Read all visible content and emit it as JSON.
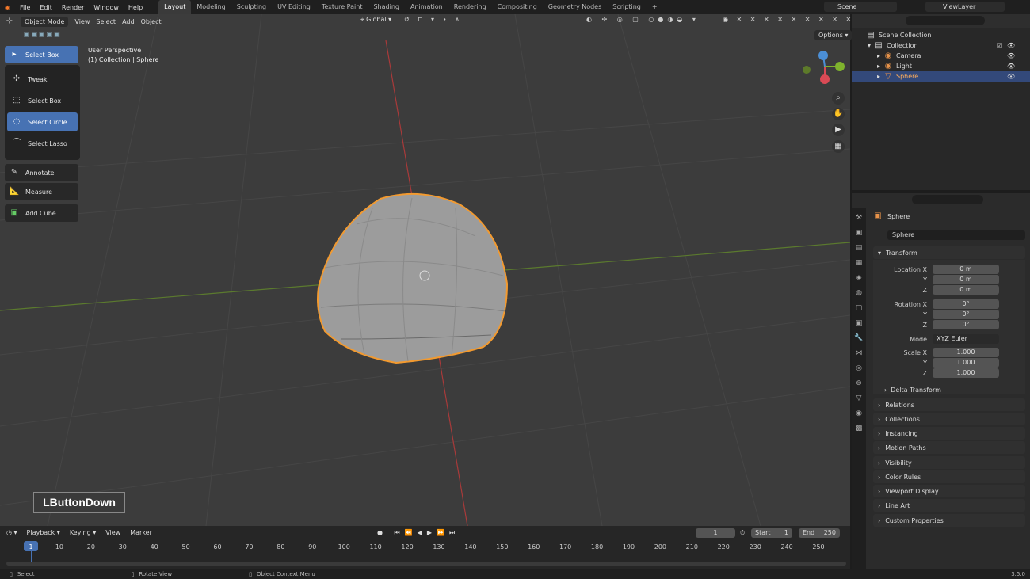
{
  "menu": [
    "File",
    "Edit",
    "Render",
    "Window",
    "Help"
  ],
  "workspaces": [
    "Layout",
    "Modeling",
    "Sculpting",
    "UV Editing",
    "Texture Paint",
    "Shading",
    "Animation",
    "Rendering",
    "Compositing",
    "Geometry Nodes",
    "Scripting"
  ],
  "scene": "Scene",
  "view_layer": "ViewLayer",
  "viewport": {
    "mode": "Object Mode",
    "header_menus": [
      "View",
      "Select",
      "Add",
      "Object"
    ],
    "orientation": "Global",
    "options": "Options",
    "perspective": "User Perspective",
    "collection_info": "(1) Collection | Sphere"
  },
  "toolbar": {
    "active": "Select Box",
    "flyout": [
      "Tweak",
      "Select Box",
      "Select Circle",
      "Select Lasso"
    ],
    "tools": [
      "Annotate",
      "Measure",
      "Add Cube"
    ]
  },
  "overlay_key": "LButtonDown",
  "outliner": {
    "root": "Scene Collection",
    "collection": "Collection",
    "items": [
      "Camera",
      "Light",
      "Sphere"
    ]
  },
  "properties": {
    "object": "Sphere",
    "datablock": "Sphere",
    "transform": "Transform",
    "location_label": "Location X",
    "rotation_label": "Rotation X",
    "scale_label": "Scale X",
    "axis_y": "Y",
    "axis_z": "Z",
    "mode_label": "Mode",
    "mode_value": "XYZ Euler",
    "loc": [
      "0 m",
      "0 m",
      "0 m"
    ],
    "rot": [
      "0°",
      "0°",
      "0°"
    ],
    "scale": [
      "1.000",
      "1.000",
      "1.000"
    ],
    "delta": "Delta Transform",
    "sections": [
      "Relations",
      "Collections",
      "Instancing",
      "Motion Paths",
      "Visibility",
      "Color Rules",
      "Viewport Display",
      "Line Art",
      "Custom Properties"
    ]
  },
  "timeline": {
    "menus": [
      "Playback",
      "Keying",
      "View",
      "Marker"
    ],
    "current_frame": "1",
    "start_label": "Start",
    "start": "1",
    "end_label": "End",
    "end": "250",
    "ticks": [
      "1",
      "10",
      "20",
      "30",
      "40",
      "50",
      "60",
      "70",
      "80",
      "90",
      "100",
      "110",
      "120",
      "130",
      "140",
      "150",
      "160",
      "170",
      "180",
      "190",
      "200",
      "210",
      "220",
      "230",
      "240",
      "250"
    ]
  },
  "status": {
    "select": "Select",
    "rotate": "Rotate View",
    "context": "Object Context Menu",
    "version": "3.5.0"
  }
}
